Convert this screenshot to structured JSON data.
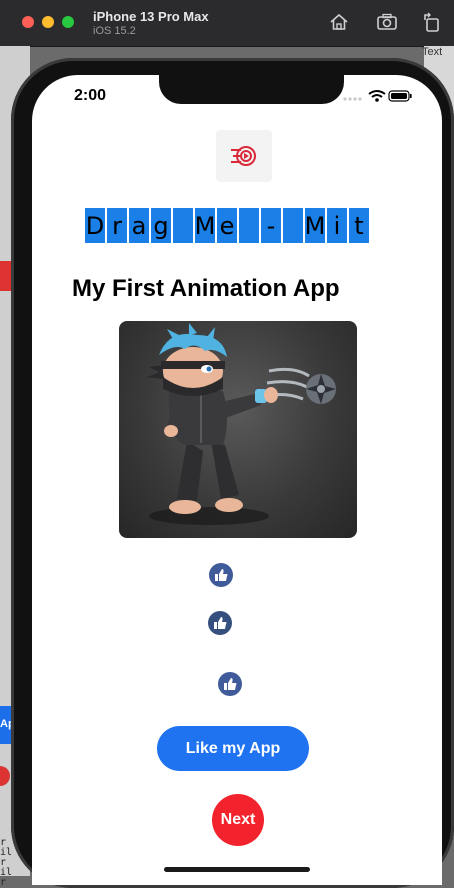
{
  "simulator": {
    "device_name": "iPhone 13 Pro Max",
    "os_version": "iOS 15.2"
  },
  "background": {
    "right_label": "Text",
    "left_mono_lines": [
      "r",
      "il",
      "r",
      "il",
      "r"
    ],
    "left_label_ap": "Ap"
  },
  "status_bar": {
    "time": "2:00"
  },
  "app": {
    "drag_label_chars": [
      "D",
      "r",
      "a",
      "g",
      " ",
      "M",
      "e",
      " ",
      "-",
      " ",
      "M",
      "i",
      "t"
    ],
    "title": "My First Animation App",
    "like_button": "Like my App",
    "next_button": "Next",
    "accent_blue": "#1f73f0",
    "next_red": "#f2232d",
    "thumb_color": "#3f5b9a"
  },
  "icons": {
    "home": "home-icon",
    "screenshot": "camera-icon",
    "rotate": "rotate-icon",
    "logo": "app-logo-icon",
    "thumbs": "thumbs-up-icon"
  }
}
